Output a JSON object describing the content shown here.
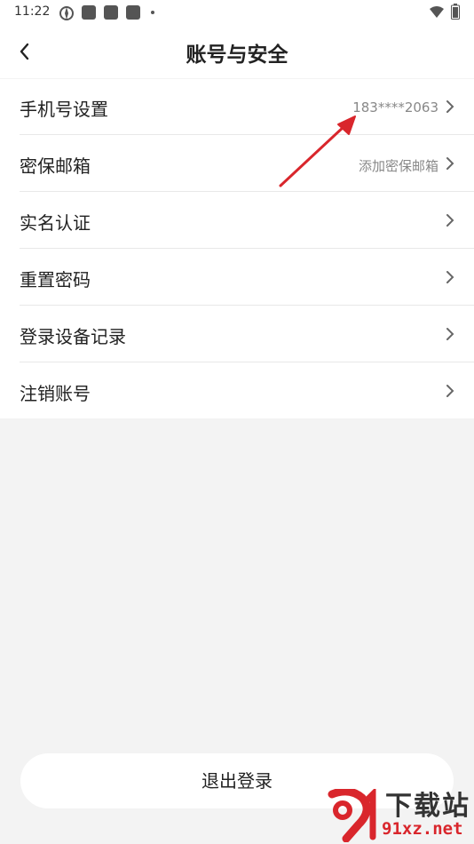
{
  "status_bar": {
    "time": "11:22"
  },
  "header": {
    "title": "账号与安全"
  },
  "menu": {
    "items": [
      {
        "label": "手机号设置",
        "value": "183****2063"
      },
      {
        "label": "密保邮箱",
        "value": "添加密保邮箱"
      },
      {
        "label": "实名认证",
        "value": ""
      },
      {
        "label": "重置密码",
        "value": ""
      },
      {
        "label": "登录设备记录",
        "value": ""
      },
      {
        "label": "注销账号",
        "value": ""
      }
    ]
  },
  "logout": {
    "label": "退出登录"
  },
  "watermark": {
    "line1": "下载站",
    "line2": "91xz.net"
  },
  "colors": {
    "annotation_arrow": "#d9262c",
    "background": "#f3f3f3"
  },
  "icons": [
    "back-arrow-icon",
    "chevron-right-icon",
    "wifi-icon",
    "battery-icon",
    "pinwheel-icon"
  ]
}
